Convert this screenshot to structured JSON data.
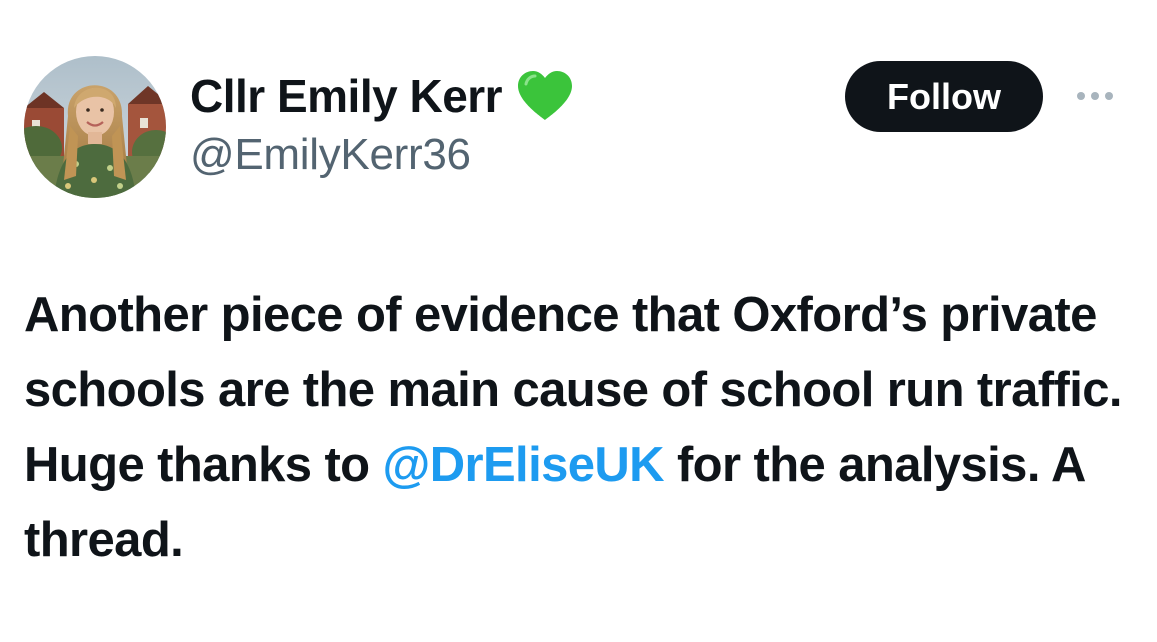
{
  "author": {
    "name": "Cllr Emily Kerr",
    "handle": "@EmilyKerr36",
    "badge_icon": "green-heart-icon",
    "badge_color": "#3bc43b"
  },
  "actions": {
    "follow_label": "Follow",
    "more_icon": "more-dots-icon"
  },
  "tweet": {
    "text_before": "Another piece of evidence that Oxford’s private schools are the main cause of school run traffic. Huge thanks to ",
    "mention": "@DrEliseUK",
    "text_after": " for the analysis. A thread."
  },
  "colors": {
    "text": "#0f1419",
    "secondary": "#536471",
    "link": "#1d9bf0",
    "button_bg": "#0f1419"
  }
}
